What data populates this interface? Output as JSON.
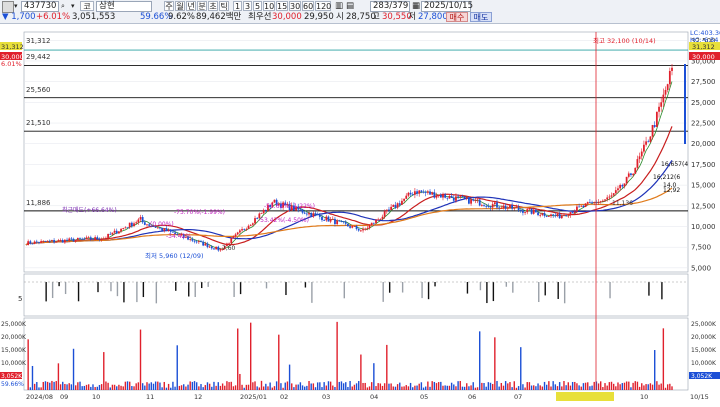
{
  "toolbar": {
    "row1": {
      "stock_code": "437730",
      "stock_name": "삼현",
      "market_badge": "코",
      "period_buttons": [
        "주",
        "월",
        "년",
        "분",
        "초",
        "틱"
      ],
      "interval_buttons": [
        "1",
        "3",
        "5",
        "10",
        "15",
        "30",
        "60",
        "120"
      ],
      "count_display": "283/379",
      "date": "2025/10/15",
      "buy_label": "매수",
      "sell_label": "매도"
    },
    "row2": {
      "change": "▼ 1,700",
      "change_pct": "+6.01%",
      "volume": "3,051,553",
      "ratio1": "59.66%",
      "ratio2": "9.62%",
      "trade_amount": "89,462백만",
      "price_type": "최우선",
      "price_main": "30,000",
      "open": "29,950",
      "high_label": "시",
      "high": "28,750",
      "mid_label": "고",
      "mid": "30,550",
      "low_label": "저",
      "low": "27,800"
    }
  },
  "price_axis": {
    "ticks": [
      "32,500",
      "30,000",
      "27,500",
      "25,000",
      "22,500",
      "20,000",
      "17,500",
      "15,000",
      "12,500",
      "10,000",
      "7,500",
      "5,000"
    ],
    "current_price_tag": "30,000",
    "high_tag": "31,312",
    "top_right_tag1": "LC:403.36",
    "top_right_tag2": "HC:-6.54"
  },
  "left_axis": {
    "tag_high": "31,312",
    "tag_current": "30,000",
    "tag_pct": "6.01%"
  },
  "horizontal_lines": [
    {
      "label": "31,312"
    },
    {
      "label": "29,442"
    },
    {
      "label": "25,560"
    },
    {
      "label": "21,510"
    },
    {
      "label": "11,886"
    }
  ],
  "annotations": {
    "max_label": "최고 32,100 (10/14)",
    "min_label": "최저 5,960 (12/09)",
    "right_labels": [
      "16,657(4",
      "16,212(6",
      "14,0",
      "12,92",
      "12,"
    ],
    "buy_signal_1": "최근매도(+66.64%)",
    "mid_labels": [
      "-75.70%(-1.99%)",
      "-51.62%(-1.22%)",
      "-1.33%",
      "(0.00%)",
      "-53.42%(-4.50%)",
      "-47.06%(-4.20%)",
      "-34.42%"
    ],
    "label_1136": "11,136",
    "label_7600": "7,60"
  },
  "indicator_panel": {
    "axis_label": "5"
  },
  "volume_panel": {
    "ticks_left": [
      "25,000K",
      "20,000K",
      "15,000K",
      "10,000K",
      "5,000K"
    ],
    "ticks_right": [
      "25,000K",
      "20,000K",
      "15,000K",
      "10,000K",
      "5,000K"
    ],
    "current_tag_left": "3,052K",
    "current_tag_right": "3,052K",
    "pct_tag": "59.66%"
  },
  "x_axis": {
    "labels": [
      "2024/08",
      "09",
      "10",
      "11",
      "12",
      "2025/01",
      "02",
      "03",
      "04",
      "05",
      "06",
      "07",
      "08",
      "2025/08/25(월)",
      "10",
      "10/15"
    ]
  },
  "colors": {
    "up": "#e0202c",
    "down": "#1b4fd6",
    "ma_red": "#c81e1e",
    "ma_blue": "#1f33b8",
    "ma_orange": "#e07a1a",
    "ma_green": "#2a8a2a"
  }
}
